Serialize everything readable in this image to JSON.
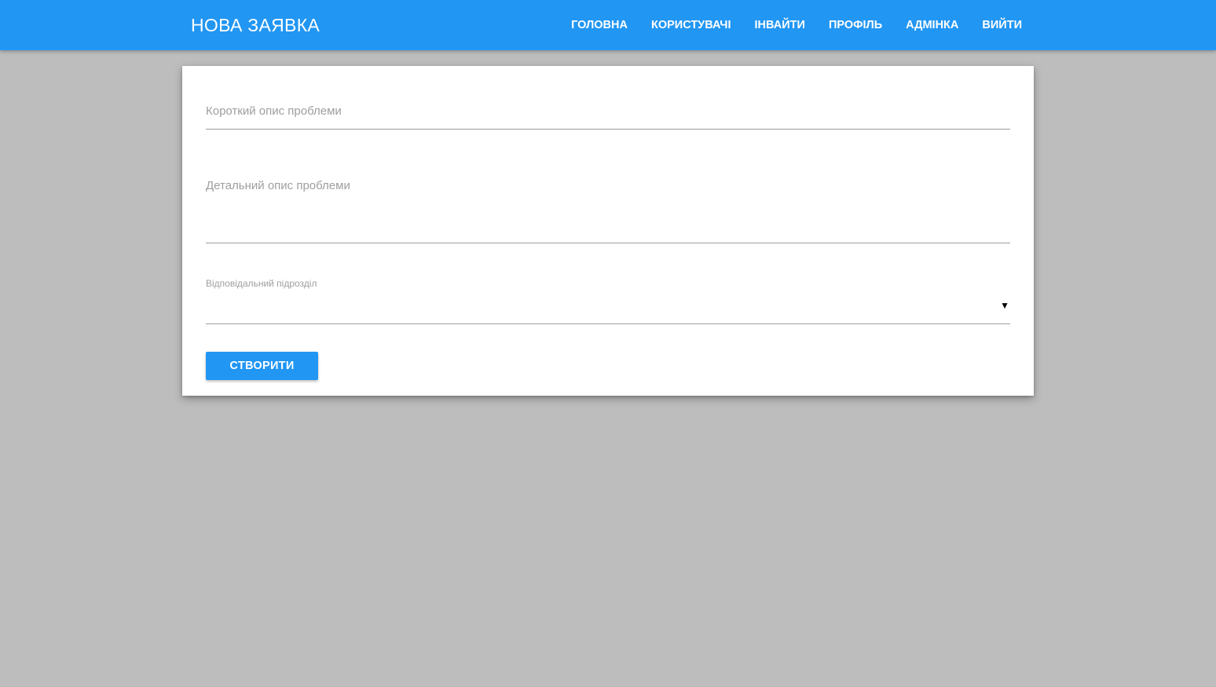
{
  "app": {
    "title": "НОВА ЗАЯВКА"
  },
  "nav": {
    "items": [
      {
        "label": "ГОЛОВНА"
      },
      {
        "label": "КОРИСТУВАЧІ"
      },
      {
        "label": "ІНВАЙТИ"
      },
      {
        "label": "ПРОФІЛЬ"
      },
      {
        "label": "АДМІНКА"
      },
      {
        "label": "ВИЙТИ"
      }
    ]
  },
  "form": {
    "short_description": {
      "value": "",
      "placeholder": "Короткий опис проблеми"
    },
    "detailed_description": {
      "value": "",
      "placeholder": "Детальний опис проблеми"
    },
    "department": {
      "label": "Відповідальний підрозділ",
      "selected": "",
      "arrow_icon": "▼"
    },
    "submit_label": "СТВОРИТИ"
  },
  "colors": {
    "primary": "#2196f3",
    "background": "#bdbdbd",
    "card": "#ffffff",
    "placeholder": "#9e9e9e"
  }
}
